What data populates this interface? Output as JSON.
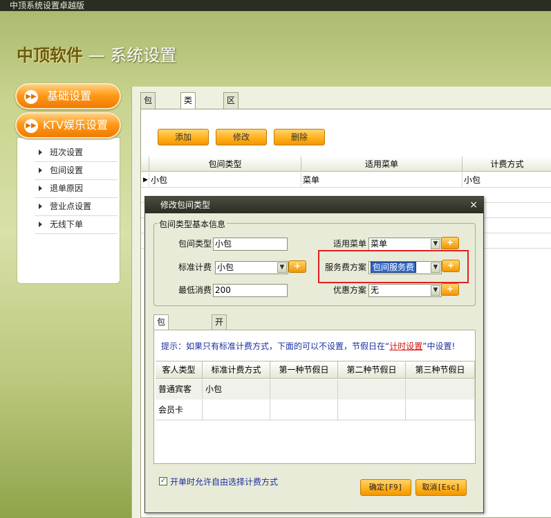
{
  "window": {
    "title": "中顶系统设置卓越版"
  },
  "brand": {
    "name": "中顶软件",
    "separator": "—",
    "section": "系统设置"
  },
  "sidebar": {
    "group1": {
      "label": "基础设置"
    },
    "group2": {
      "label": "KTV娱乐设置"
    },
    "items": [
      {
        "label": "班次设置"
      },
      {
        "label": "包间设置"
      },
      {
        "label": "退单原因"
      },
      {
        "label": "营业点设置"
      },
      {
        "label": "无线下单"
      }
    ]
  },
  "main": {
    "tabs": [
      {
        "label": "包间设置"
      },
      {
        "label": "类型设置"
      },
      {
        "label": "区域设置"
      }
    ],
    "toolbar": {
      "add": "添加",
      "edit": "修改",
      "delete": "删除"
    },
    "grid": {
      "columns": [
        "包间类型",
        "适用菜单",
        "计费方式"
      ],
      "rows": [
        [
          "小包",
          "菜单",
          "小包"
        ]
      ]
    }
  },
  "dialog": {
    "title": "修改包间类型",
    "close": "×",
    "group_label": "包间类型基本信息",
    "fields": {
      "room_type": {
        "label": "包间类型",
        "value": "小包"
      },
      "menu": {
        "label": "适用菜单",
        "value": "菜单"
      },
      "billing": {
        "label": "标准计费",
        "value": "小包"
      },
      "service_plan": {
        "label": "服务费方案",
        "value": "包间服务费"
      },
      "min_spend": {
        "label": "最低消费",
        "value": "200"
      },
      "discount": {
        "label": "优惠方案",
        "value": "无"
      }
    },
    "plus": "+",
    "subtabs": [
      {
        "label": "包间计费方案"
      },
      {
        "label": "开单自动加单项目"
      }
    ],
    "tip": {
      "before": "提示：如果只有标准计费方式，下面的可以不设置，节假日在“",
      "link": "计时设置",
      "after": "”中设置!"
    },
    "plan_grid": {
      "columns": [
        "客人类型",
        "标准计费方式",
        "第一种节假日",
        "第二种节假日",
        "第三种节假日"
      ],
      "rows": [
        [
          "普通宾客",
          "小包",
          "",
          "",
          ""
        ],
        [
          "会员卡",
          "",
          "",
          "",
          ""
        ]
      ]
    },
    "checkbox": {
      "label": "开单时允许自由选择计费方式",
      "checked": true,
      "mark": "✓"
    },
    "ok": "确定[F9]",
    "cancel": "取消[Esc]"
  }
}
